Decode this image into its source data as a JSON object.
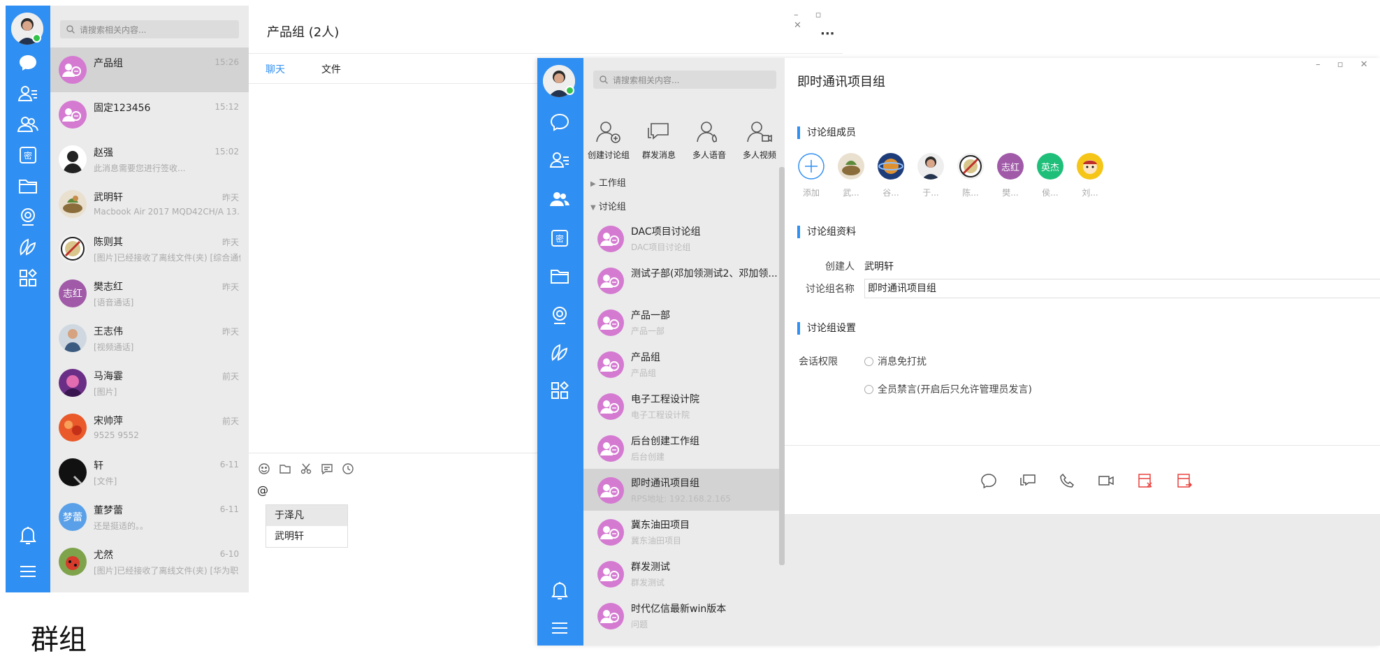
{
  "win1": {
    "search_placeholder": "请搜索相关内容...",
    "chat_title": "产品组 (2人)",
    "more_label": "···",
    "window_controls": "–  ▫  ✕",
    "tabs": [
      {
        "label": "聊天",
        "active": true
      },
      {
        "label": "文件",
        "active": false
      }
    ],
    "input_text": "@",
    "mention_options": [
      "于泽凡",
      "武明轩"
    ],
    "conversations": [
      {
        "name": "产品组",
        "preview": "",
        "time": "15:26",
        "avatar": "group",
        "selected": true
      },
      {
        "name": "固定123456",
        "preview": "",
        "time": "15:12",
        "avatar": "group"
      },
      {
        "name": "赵强",
        "preview": "此消息需要您进行签收...",
        "time": "15:02",
        "avatar": "person-silhouette"
      },
      {
        "name": "武明轩",
        "preview": "Macbook Air 2017 MQD42CH/A 13.",
        "time": "昨天",
        "avatar": "photo-food"
      },
      {
        "name": "陈则其",
        "preview": "[图片]已经接收了离线文件(夹) [综合通信",
        "time": "昨天",
        "avatar": "photo-badge"
      },
      {
        "name": "樊志红",
        "preview": "[语音通话]",
        "time": "昨天",
        "avatar": "text",
        "avatar_text": "志红"
      },
      {
        "name": "王志伟",
        "preview": "[视频通话]",
        "time": "昨天",
        "avatar": "photo-person"
      },
      {
        "name": "马海霎",
        "preview": "[图片]",
        "time": "前天",
        "avatar": "photo-purple"
      },
      {
        "name": "宋帅萍",
        "preview": "9525 9552",
        "time": "前天",
        "avatar": "photo-orange"
      },
      {
        "name": "轩",
        "preview": "[文件]",
        "time": "6-11",
        "avatar": "photo-black"
      },
      {
        "name": "董梦蕾",
        "preview": "还是挺适的。。",
        "time": "6-11",
        "avatar": "text",
        "avatar_text": "梦蕾"
      },
      {
        "name": "尤然",
        "preview": "[图片]已经接收了离线文件(夹) [华为职",
        "time": "6-10",
        "avatar": "photo-bug"
      }
    ]
  },
  "caption": "群组",
  "win2": {
    "search_placeholder": "请搜索相关内容...",
    "window_controls": "–  ▫  ✕",
    "quick_actions": [
      {
        "label": "创建讨论组",
        "icon": "create-group-icon"
      },
      {
        "label": "群发消息",
        "icon": "broadcast-icon"
      },
      {
        "label": "多人语音",
        "icon": "multi-voice-icon"
      },
      {
        "label": "多人视频",
        "icon": "multi-video-icon"
      }
    ],
    "tree": [
      {
        "label": "工作组",
        "expanded": false
      },
      {
        "label": "讨论组",
        "expanded": true
      }
    ],
    "groups": [
      {
        "name": "DAC项目讨论组",
        "preview": "DAC项目讨论组"
      },
      {
        "name": "测试子部(邓加领测试2、邓加领...",
        "preview": ""
      },
      {
        "name": "产品一部",
        "preview": "产品一部"
      },
      {
        "name": "产品组",
        "preview": "产品组"
      },
      {
        "name": "电子工程设计院",
        "preview": "电子工程设计院"
      },
      {
        "name": "后台创建工作组",
        "preview": "后台创建"
      },
      {
        "name": "即时通讯项目组",
        "preview": "RPS地址: 192.168.2.165",
        "selected": true
      },
      {
        "name": "冀东油田项目",
        "preview": "冀东油田项目"
      },
      {
        "name": "群发测试",
        "preview": "群发测试"
      },
      {
        "name": "时代亿信最新win版本",
        "preview": "问题"
      }
    ],
    "detail": {
      "title": "即时通讯项目组",
      "members_section": "讨论组成员",
      "members": [
        {
          "label": "添加",
          "avatar": "add"
        },
        {
          "label": "武...",
          "avatar": "photo-food"
        },
        {
          "label": "谷...",
          "avatar": "photo-planet"
        },
        {
          "label": "于...",
          "avatar": "photo-man"
        },
        {
          "label": "陈...",
          "avatar": "photo-badge"
        },
        {
          "label": "樊...",
          "avatar": "text",
          "text": "志红",
          "color": "#a05aa8"
        },
        {
          "label": "侯...",
          "avatar": "text",
          "text": "英杰",
          "color": "#1fbf7a"
        },
        {
          "label": "刘...",
          "avatar": "photo-cartoon"
        }
      ],
      "info_section": "讨论组资料",
      "creator_label": "创建人",
      "creator_value": "武明轩",
      "name_label": "讨论组名称",
      "name_value": "即时通讯项目组",
      "settings_section": "讨论组设置",
      "permission_label": "会话权限",
      "options": [
        "消息免打扰",
        "全员禁言(开启后只允许管理员发言)"
      ],
      "actions": [
        {
          "icon": "chat-icon",
          "color": "#555"
        },
        {
          "icon": "broadcast-icon",
          "color": "#555"
        },
        {
          "icon": "phone-icon",
          "color": "#555"
        },
        {
          "icon": "video-icon",
          "color": "#555"
        },
        {
          "icon": "dismiss-group-icon",
          "color": "#e8403c"
        },
        {
          "icon": "exit-group-icon",
          "color": "#e8403c"
        }
      ]
    }
  },
  "colors": {
    "accent": "#2f8ff2",
    "group_avatar": "#d47ad1",
    "danger": "#e8403c",
    "online": "#34c24a"
  }
}
